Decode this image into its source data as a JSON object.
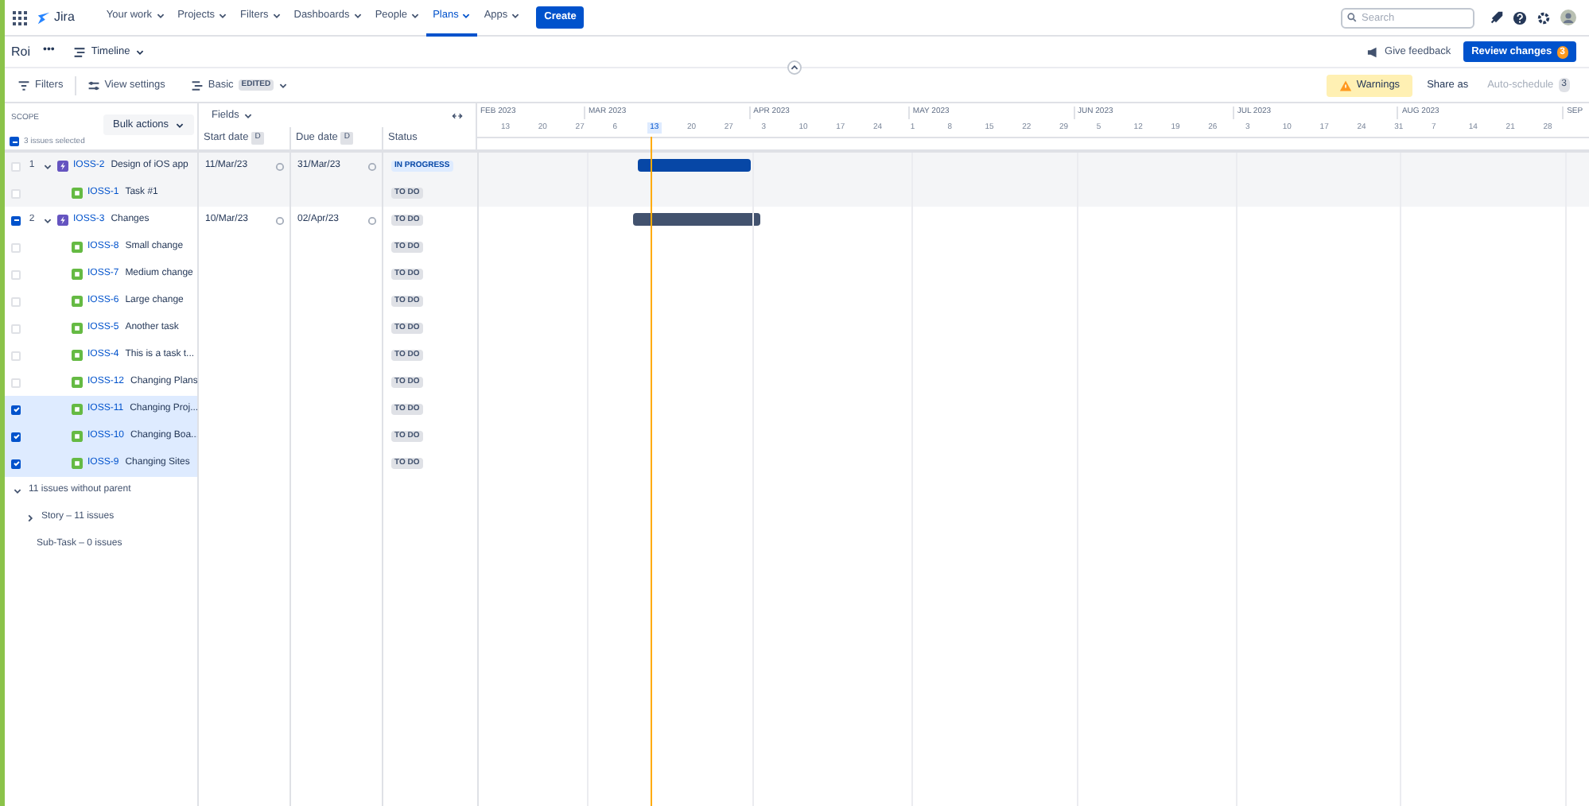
{
  "nav": {
    "product": "Jira",
    "items": [
      {
        "label": "Your work",
        "selected": false
      },
      {
        "label": "Projects",
        "selected": false
      },
      {
        "label": "Filters",
        "selected": false
      },
      {
        "label": "Dashboards",
        "selected": false
      },
      {
        "label": "People",
        "selected": false
      },
      {
        "label": "Plans",
        "selected": true
      },
      {
        "label": "Apps",
        "selected": false
      }
    ],
    "create": "Create",
    "search": {
      "placeholder": "Search"
    }
  },
  "plan_bar": {
    "name": "Roi",
    "more": "•••",
    "view": "Timeline",
    "feedback": "Give feedback",
    "review": "Review changes",
    "review_count": "3"
  },
  "toolbar": {
    "filters": "Filters",
    "view_settings": "View settings",
    "preset": "Basic",
    "preset_badge": "EDITED",
    "warnings": "Warnings",
    "share": "Share as",
    "auto_schedule": "Auto-schedule",
    "auto_schedule_count": "3"
  },
  "header": {
    "scope": "SCOPE",
    "bulk": "Bulk actions",
    "checked": false,
    "partial": true,
    "selected_text": "3 issues selected",
    "fields": "Fields",
    "columns": [
      {
        "label": "Start date",
        "badge": "D"
      },
      {
        "label": "Due date",
        "badge": "D"
      },
      {
        "label": "Status"
      }
    ]
  },
  "timeline": {
    "months": [
      "FEB 2023",
      "MAR 2023",
      "APR 2023",
      "MAY 2023",
      "JUN 2023",
      "JUL 2023",
      "AUG 2023",
      "SEP"
    ],
    "weeks": [
      {
        "label": "13",
        "today": false
      },
      {
        "label": "20",
        "today": false
      },
      {
        "label": "27",
        "today": false
      },
      {
        "label": "6",
        "today": false
      },
      {
        "label": "13",
        "today": true
      },
      {
        "label": "20",
        "today": false
      },
      {
        "label": "27",
        "today": false
      },
      {
        "label": "3",
        "today": false
      },
      {
        "label": "10",
        "today": false
      },
      {
        "label": "17",
        "today": false
      },
      {
        "label": "24",
        "today": false
      },
      {
        "label": "1",
        "today": false
      },
      {
        "label": "8",
        "today": false
      },
      {
        "label": "15",
        "today": false
      },
      {
        "label": "22",
        "today": false
      },
      {
        "label": "29",
        "today": false
      },
      {
        "label": "5",
        "today": false
      },
      {
        "label": "12",
        "today": false
      },
      {
        "label": "19",
        "today": false
      },
      {
        "label": "26",
        "today": false
      },
      {
        "label": "3",
        "today": false
      },
      {
        "label": "10",
        "today": false
      },
      {
        "label": "17",
        "today": false
      },
      {
        "label": "24",
        "today": false
      },
      {
        "label": "31",
        "today": false
      },
      {
        "label": "7",
        "today": false
      },
      {
        "label": "14",
        "today": false
      },
      {
        "label": "21",
        "today": false
      },
      {
        "label": "28",
        "today": false
      }
    ]
  },
  "rows": [
    {
      "kind": "epic",
      "number": "1",
      "key": "IOSS-2",
      "summary": "Design of iOS app",
      "checked": false,
      "partial": false,
      "selected": false,
      "shaded": true,
      "start": "11/Mar/23",
      "due": "31/Mar/23",
      "status": "IN PROGRESS",
      "in_progress": true,
      "color": "#0747a6"
    },
    {
      "kind": "task",
      "key": "IOSS-1",
      "summary": "Task #1",
      "checked": false,
      "partial": false,
      "selected": false,
      "shaded": true,
      "status": "TO DO",
      "in_progress": false
    },
    {
      "kind": "epic",
      "number": "2",
      "key": "IOSS-3",
      "summary": "Changes",
      "checked": false,
      "partial": true,
      "selected": false,
      "shaded": false,
      "start": "10/Mar/23",
      "due": "02/Apr/23",
      "status": "TO DO",
      "in_progress": false,
      "color": "#42526e"
    },
    {
      "kind": "task",
      "key": "IOSS-8",
      "summary": "Small change",
      "checked": false,
      "partial": false,
      "selected": false,
      "shaded": false,
      "status": "TO DO",
      "in_progress": false
    },
    {
      "kind": "task",
      "key": "IOSS-7",
      "summary": "Medium change",
      "checked": false,
      "partial": false,
      "selected": false,
      "shaded": false,
      "status": "TO DO",
      "in_progress": false
    },
    {
      "kind": "task",
      "key": "IOSS-6",
      "summary": "Large change",
      "checked": false,
      "partial": false,
      "selected": false,
      "shaded": false,
      "status": "TO DO",
      "in_progress": false
    },
    {
      "kind": "task",
      "key": "IOSS-5",
      "summary": "Another task",
      "checked": false,
      "partial": false,
      "selected": false,
      "shaded": false,
      "status": "TO DO",
      "in_progress": false
    },
    {
      "kind": "task",
      "key": "IOSS-4",
      "summary": "This is a task t...",
      "checked": false,
      "partial": false,
      "selected": false,
      "shaded": false,
      "status": "TO DO",
      "in_progress": false
    },
    {
      "kind": "task",
      "key": "IOSS-12",
      "summary": "Changing Plans",
      "checked": false,
      "partial": false,
      "selected": false,
      "shaded": false,
      "status": "TO DO",
      "in_progress": false
    },
    {
      "kind": "task",
      "key": "IOSS-11",
      "summary": "Changing Proj...",
      "checked": true,
      "partial": false,
      "selected": true,
      "shaded": false,
      "status": "TO DO",
      "in_progress": false
    },
    {
      "kind": "task",
      "key": "IOSS-10",
      "summary": "Changing Boa...",
      "checked": true,
      "partial": false,
      "selected": true,
      "shaded": false,
      "status": "TO DO",
      "in_progress": false
    },
    {
      "kind": "task",
      "key": "IOSS-9",
      "summary": "Changing Sites",
      "checked": true,
      "partial": false,
      "selected": true,
      "shaded": false,
      "status": "TO DO",
      "in_progress": false
    }
  ],
  "groups": [
    {
      "label": "11 issues without parent",
      "expanded": true,
      "children": [
        {
          "label": "Story – 11 issues",
          "expanded": false
        },
        {
          "label": "Sub-Task – 0 issues"
        }
      ]
    }
  ]
}
